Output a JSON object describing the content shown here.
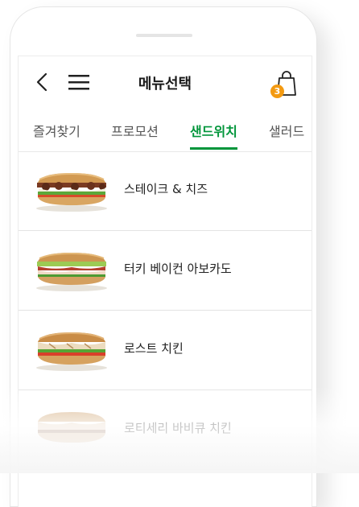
{
  "header": {
    "title": "메뉴선택",
    "back_icon": "chevron-left-icon",
    "menu_icon": "hamburger-menu-icon",
    "cart_icon": "shopping-bag-icon",
    "cart_count": "3"
  },
  "tabs": [
    {
      "label": "즐겨찾기",
      "active": false
    },
    {
      "label": "프로모션",
      "active": false
    },
    {
      "label": "샌드위치",
      "active": true
    },
    {
      "label": "샐러드",
      "active": false
    }
  ],
  "menu_items": [
    {
      "name": "스테이크 & 치즈",
      "image": "steak-cheese-sandwich"
    },
    {
      "name": "터키 베이컨 아보카도",
      "image": "turkey-bacon-avocado-sandwich"
    },
    {
      "name": "로스트 치킨",
      "image": "roast-chicken-sandwich"
    },
    {
      "name": "로티세리 바비큐 치킨",
      "image": "rotisserie-bbq-chicken-sandwich"
    }
  ],
  "colors": {
    "accent": "#00953a",
    "badge": "#f39a11",
    "text": "#222222",
    "tab_inactive": "#555555"
  }
}
